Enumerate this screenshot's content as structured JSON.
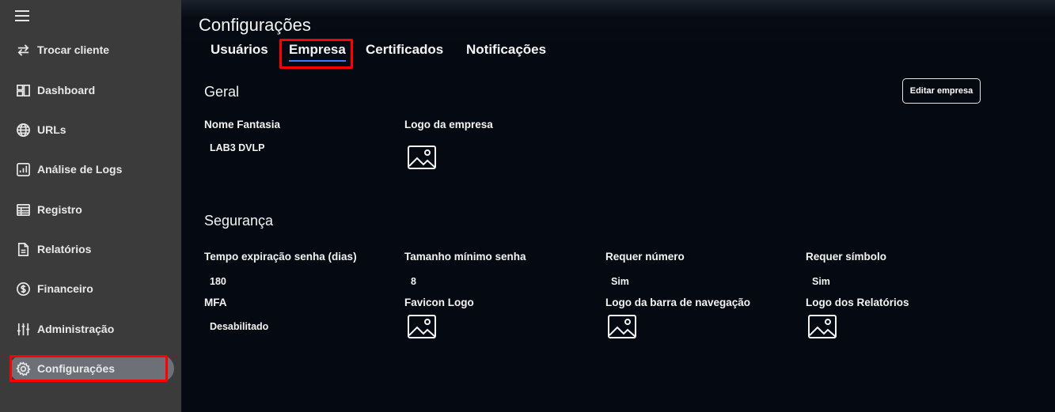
{
  "sidebar": {
    "items": [
      {
        "label": "Trocar cliente",
        "icon": "swap-arrows-icon"
      },
      {
        "label": "Dashboard",
        "icon": "dashboard-icon"
      },
      {
        "label": "URLs",
        "icon": "globe-icon"
      },
      {
        "label": "Análise de Logs",
        "icon": "bar-chart-icon"
      },
      {
        "label": "Registro",
        "icon": "table-icon"
      },
      {
        "label": "Relatórios",
        "icon": "document-icon"
      },
      {
        "label": "Financeiro",
        "icon": "dollar-icon"
      },
      {
        "label": "Administração",
        "icon": "sliders-icon"
      },
      {
        "label": "Configurações",
        "icon": "gear-icon"
      }
    ],
    "active": "Configurações"
  },
  "page": {
    "title": "Configurações",
    "tabs": [
      "Usuários",
      "Empresa",
      "Certificados",
      "Notificações"
    ],
    "active_tab": "Empresa"
  },
  "geral": {
    "title": "Geral",
    "edit_button": "Editar empresa",
    "nome_fantasia_label": "Nome Fantasia",
    "nome_fantasia_value": "LAB3 DVLP",
    "logo_label": "Logo da empresa"
  },
  "seguranca": {
    "title": "Segurança",
    "fields": [
      {
        "label": "Tempo expiração senha (dias)",
        "value": "180"
      },
      {
        "label": "Tamanho mínimo senha",
        "value": "8"
      },
      {
        "label": "Requer número",
        "value": "Sim"
      },
      {
        "label": "Requer símbolo",
        "value": "Sim"
      }
    ],
    "mfa_label": "MFA",
    "mfa_value": "Desabilitado",
    "favicon_label": "Favicon Logo",
    "navbar_logo_label": "Logo da barra de navegação",
    "reports_logo_label": "Logo dos Relatórios"
  },
  "colors": {
    "sidebar_bg": "#3b3b3b",
    "main_bg": "#050a12",
    "active_item_bg": "#6e7078",
    "tab_underline": "#3d7ef0",
    "highlight": "#ff0000"
  }
}
